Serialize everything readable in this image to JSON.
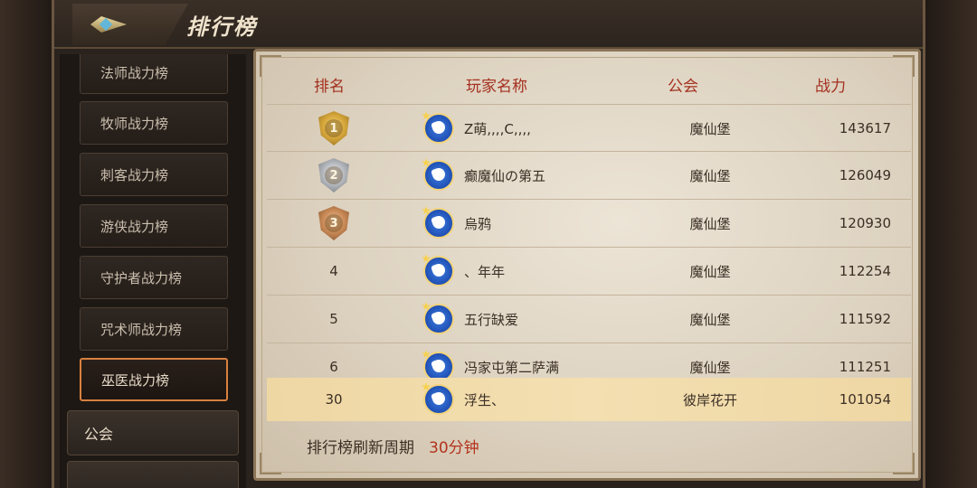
{
  "header": {
    "title": "排行榜",
    "back_icon": "back-gem-icon"
  },
  "sidebar": {
    "items": [
      {
        "label": "法师战力榜",
        "active": false
      },
      {
        "label": "牧师战力榜",
        "active": false
      },
      {
        "label": "刺客战力榜",
        "active": false
      },
      {
        "label": "游侠战力榜",
        "active": false
      },
      {
        "label": "守护者战力榜",
        "active": false
      },
      {
        "label": "咒术师战力榜",
        "active": false
      },
      {
        "label": "巫医战力榜",
        "active": true
      }
    ],
    "groups": [
      {
        "label": "公会"
      }
    ]
  },
  "table": {
    "columns": {
      "rank": "排名",
      "name": "玩家名称",
      "guild": "公会",
      "power": "战力"
    },
    "rows": [
      {
        "rank": "1",
        "medal": "gold",
        "name": "Z萌,,,,C,,,,",
        "guild": "魔仙堡",
        "power": "143617"
      },
      {
        "rank": "2",
        "medal": "silver",
        "name": "癫魔仙の第五",
        "guild": "魔仙堡",
        "power": "126049"
      },
      {
        "rank": "3",
        "medal": "bronze",
        "name": "烏鸦",
        "guild": "魔仙堡",
        "power": "120930"
      },
      {
        "rank": "4",
        "medal": "",
        "name": "、年年",
        "guild": "魔仙堡",
        "power": "112254"
      },
      {
        "rank": "5",
        "medal": "",
        "name": "五行缺爱",
        "guild": "魔仙堡",
        "power": "111592"
      },
      {
        "rank": "6",
        "medal": "",
        "name": "冯家屯第二萨满",
        "guild": "魔仙堡",
        "power": "111251"
      }
    ],
    "me": {
      "rank": "30",
      "name": "浮生、",
      "guild": "彼岸花开",
      "power": "101054"
    }
  },
  "footer": {
    "label": "排行榜刷新周期",
    "value": "30分钟"
  },
  "colors": {
    "header_red": "#a4301f",
    "highlight": "#f3dfb1",
    "active_border": "#d8813f"
  }
}
